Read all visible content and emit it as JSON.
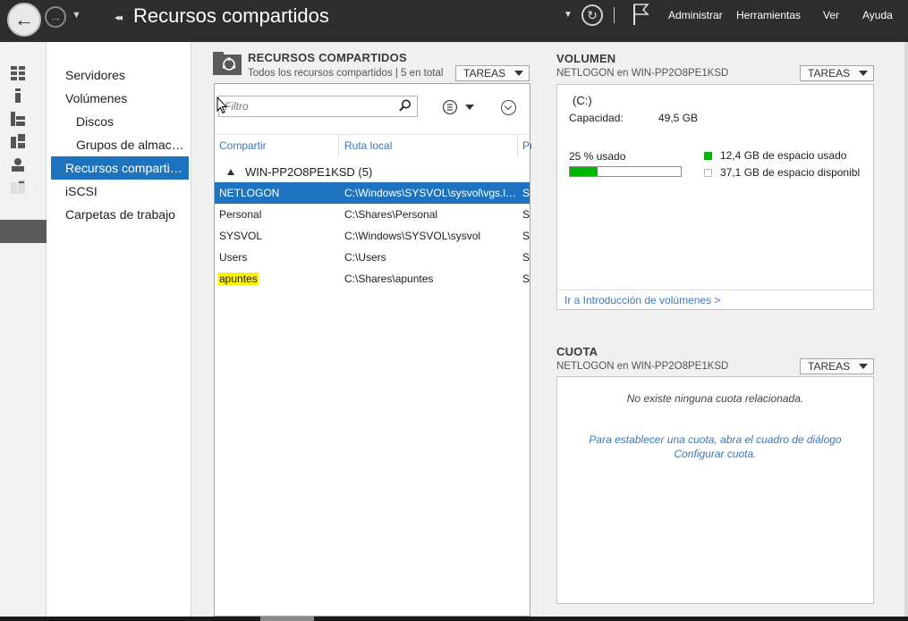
{
  "titlebar": {
    "title": "Recursos compartidos",
    "menu": [
      "Administrar",
      "Herramientas",
      "Ver",
      "Ayuda"
    ]
  },
  "rail": {
    "icons": [
      "dashboard-icon",
      "local-server-icon",
      "all-servers-icon",
      "roles-icon",
      "remote-desktop-icon",
      "file-services-icon"
    ]
  },
  "nav": {
    "items": [
      {
        "label": "Servidores",
        "sub": false,
        "selected": false
      },
      {
        "label": "Volúmenes",
        "sub": false,
        "selected": false
      },
      {
        "label": "Discos",
        "sub": true,
        "selected": false
      },
      {
        "label": "Grupos de almacenamiento",
        "sub": true,
        "selected": false
      },
      {
        "label": "Recursos compartidos",
        "sub": false,
        "selected": true
      },
      {
        "label": "iSCSI",
        "sub": false,
        "selected": false
      },
      {
        "label": "Carpetas de trabajo",
        "sub": false,
        "selected": false
      }
    ]
  },
  "shares": {
    "title": "RECURSOS COMPARTIDOS",
    "subtitle": "Todos los recursos compartidos | 5 en total",
    "tasks_label": "TAREAS",
    "filter_placeholder": "Filtro",
    "columns": [
      "Compartir",
      "Ruta local",
      "Protocolo"
    ],
    "group_label": "WIN-PP2O8PE1KSD (5)",
    "rows": [
      {
        "share": "NETLOGON",
        "path": "C:\\Windows\\SYSVOL\\sysvol\\vgs.local\\SCRIPTS",
        "protocol": "SMB",
        "selected": true,
        "highlight": false
      },
      {
        "share": "Personal",
        "path": "C:\\Shares\\Personal",
        "protocol": "SMB",
        "selected": false,
        "highlight": false
      },
      {
        "share": "SYSVOL",
        "path": "C:\\Windows\\SYSVOL\\sysvol",
        "protocol": "SMB",
        "selected": false,
        "highlight": false
      },
      {
        "share": "Users",
        "path": "C:\\Users",
        "protocol": "SMB",
        "selected": false,
        "highlight": false
      },
      {
        "share": "apuntes",
        "path": "C:\\Shares\\apuntes",
        "protocol": "SMB",
        "selected": false,
        "highlight": true
      }
    ]
  },
  "volume": {
    "title": "VOLUMEN",
    "subtitle": "NETLOGON en WIN-PP2O8PE1KSD",
    "tasks_label": "TAREAS",
    "drive": "(C:)",
    "capacity_label": "Capacidad:",
    "capacity_value": "49,5 GB",
    "used_label": "25 % usado",
    "used_fraction": 0.25,
    "used_space": "12,4 GB de espacio usado",
    "free_space": "37,1 GB de espacio disponible",
    "link": "Ir a Introducción de volúmenes >",
    "used_color": "#00b800",
    "free_color": "#ffffff"
  },
  "quota": {
    "title": "CUOTA",
    "subtitle": "NETLOGON en WIN-PP2O8PE1KSD",
    "tasks_label": "TAREAS",
    "message": "No existe ninguna cuota relacionada.",
    "help": "Para establecer una cuota, abra el cuadro de diálogo Configurar cuota."
  }
}
